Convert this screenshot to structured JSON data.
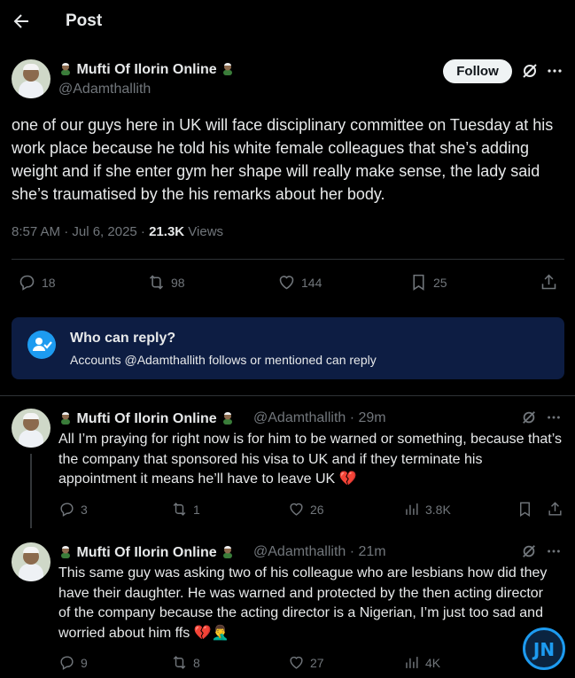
{
  "header": {
    "title": "Post"
  },
  "post": {
    "display_name": "Mufti Of Ilorin Online",
    "handle": "@Adamthallith",
    "follow_label": "Follow",
    "text": "one of our guys here in UK will face disciplinary committee on Tuesday at his work place because he told his white female colleagues that she’s adding weight and if she enter gym her shape will really make sense, the lady said she’s traumatised by the  his remarks about her body.",
    "time": "8:57 AM · Jul 6, 2025 · ",
    "views_count": "21.3K",
    "views_label": " Views",
    "stats": {
      "replies": "18",
      "reposts": "98",
      "likes": "144",
      "bookmarks": "25"
    }
  },
  "reply_restriction": {
    "title": "Who can reply?",
    "subtitle": "Accounts @Adamthallith follows or mentioned can reply"
  },
  "replies": [
    {
      "display_name": "Mufti Of Ilorin Online",
      "handle_time": "@Adamthallith · 29m",
      "text": "All I’m praying for right now is for him to be warned or something, because that’s the company that sponsored his visa to UK and if they terminate his appointment it means he’ll have to leave UK 💔",
      "replies": "3",
      "reposts": "1",
      "likes": "26",
      "views": "3.8K"
    },
    {
      "display_name": "Mufti Of Ilorin Online",
      "handle_time": "@Adamthallith · 21m",
      "text": "This same guy was asking two of his colleague who are lesbians how did they have their daughter. He was warned and protected by the then acting director of the company because the acting director is a Nigerian, I’m just too sad and worried about him ffs 💔🤦‍♂️",
      "replies": "9",
      "reposts": "8",
      "likes": "27",
      "views": "4K"
    }
  ],
  "watermark": {
    "text": "JN"
  },
  "colors": {
    "accent": "#1d9bf0",
    "muted": "#71767b",
    "reply_box_bg": "#0d1d43"
  }
}
